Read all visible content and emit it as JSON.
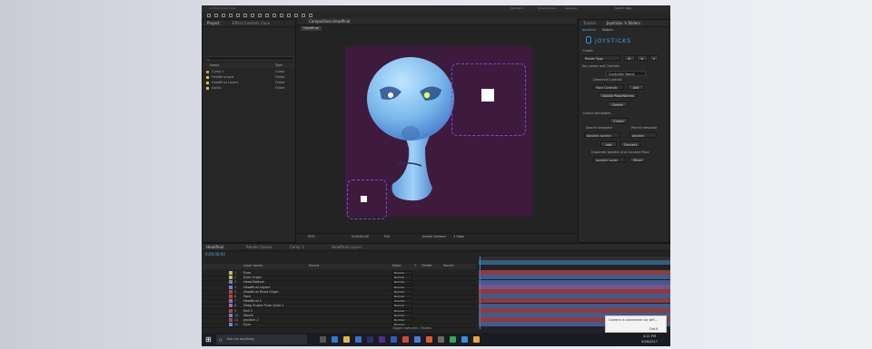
{
  "menubar": {
    "title": "Untitled Project.aep",
    "workspace_items": [
      "Standard",
      "Small Screen",
      "Libraries"
    ],
    "search_placeholder": "Search Help"
  },
  "project_panel": {
    "tabs": [
      "Project",
      "Effect Controls: Face"
    ],
    "search_placeholder": "",
    "columns": [
      "Name",
      "Type"
    ],
    "items": [
      {
        "name": "Comp 1",
        "type": "Comp",
        "color": "#b8a04a"
      },
      {
        "name": "Headfinal.psd",
        "type": "Folder",
        "color": "#d4c24a"
      },
      {
        "name": "Headfinal Layers",
        "type": "Folder",
        "color": "#d4c24a"
      },
      {
        "name": "Solids",
        "type": "Folder",
        "color": "#d4c24a"
      }
    ]
  },
  "composition": {
    "tab_label": "Composition Headfinal",
    "breadcrumb": "Headfinal",
    "zoom": "50%",
    "resolution": "Full",
    "camera": "Active Camera",
    "views": "1 View",
    "timecode": "0;00;00;00"
  },
  "joysticks_panel": {
    "tabs": [
      "Tracker",
      "Joysticks 'n Sliders"
    ],
    "subtabs": [
      "Joysticks",
      "Sliders"
    ],
    "logo_text": "JOYSTICKS",
    "section_create": "Create",
    "create_preset": "Preset Type",
    "section_poses": "Key poses and Controls",
    "controller_name": "Controller Name",
    "detected_label": "Detected Controls",
    "controls_dd": "Face Controls",
    "add_button": "Add",
    "update_button": "Update Pose/Names",
    "delete_button": "Delete",
    "section_controls": "Control templates",
    "create_button": "Create",
    "search_template_label": "Search template",
    "parent_label": "Parent template",
    "template_dd": "Joystick control",
    "parent_dd": "Joystick",
    "add_button2": "Add",
    "connect_button": "Connect",
    "duplicate_label": "Duplicate Joystick and Connect Pose",
    "duplicate_dd": "Joystick Layer",
    "move_button": "Move"
  },
  "timeline": {
    "tabs": [
      "Headfinal",
      "Render Queue",
      "Comp 1",
      "Headfinal Layers"
    ],
    "timecode": "0;00;00;00",
    "columns": [
      "Layer Name",
      "Parent",
      "Mode",
      "T",
      "TrkMat",
      "Parent"
    ],
    "layers": [
      {
        "num": "1",
        "name": "Eyes",
        "color": "#c8b85a",
        "mode": "Normal",
        "bar_color": "#b64444"
      },
      {
        "num": "2",
        "name": "Eyes Origin",
        "color": "#c8b85a",
        "mode": "Normal",
        "bar_color": "#4a6fb5"
      },
      {
        "num": "3",
        "name": "Head Bottom",
        "color": "#6a86c9",
        "mode": "Normal",
        "bar_color": "#4a6fb5"
      },
      {
        "num": "4",
        "name": "Headfinal Layers",
        "color": "#6a86c9",
        "mode": "Normal",
        "bar_color": "#9a66b3"
      },
      {
        "num": "5",
        "name": "Headfinal Head Origin",
        "color": "#b64444",
        "mode": "Normal",
        "bar_color": "#b64444"
      },
      {
        "num": "6",
        "name": "Face",
        "color": "#b64444",
        "mode": "Normal",
        "bar_color": "#4a6fb5"
      },
      {
        "num": "7",
        "name": "Headfinal 1",
        "color": "#9a66b3",
        "mode": "Overlay",
        "bar_color": "#b64444"
      },
      {
        "num": "8",
        "name": "Deep Purple Plum Solid 1",
        "color": "#9a66b3",
        "mode": "Normal",
        "bar_color": "#4a6fb5"
      },
      {
        "num": "9",
        "name": "Null 1",
        "color": "#b64444",
        "mode": "Normal",
        "bar_color": "#b64444"
      },
      {
        "num": "10",
        "name": "Mouth",
        "color": "#6a86c9",
        "mode": "Normal",
        "bar_color": "#4a6fb5"
      },
      {
        "num": "11",
        "name": "Joystick 2",
        "color": "#b64444",
        "mode": "Normal",
        "bar_color": "#b64444"
      },
      {
        "num": "12",
        "name": "Eyes",
        "color": "#6a86c9",
        "mode": "Normal",
        "bar_color": "#4a6fb5"
      }
    ],
    "footer": "Toggle Switches / Modes"
  },
  "notification": {
    "text": "Camera is connected via wifi...",
    "button": "Got it"
  },
  "taskbar": {
    "search_placeholder": "Ask me anything",
    "time": "4:21 PM",
    "date": "4/26/2017"
  },
  "colors": {
    "canvas": "#3e1a3d",
    "selection_dash": "#7a4ed6",
    "panel_accent": "#2e8fd6"
  }
}
